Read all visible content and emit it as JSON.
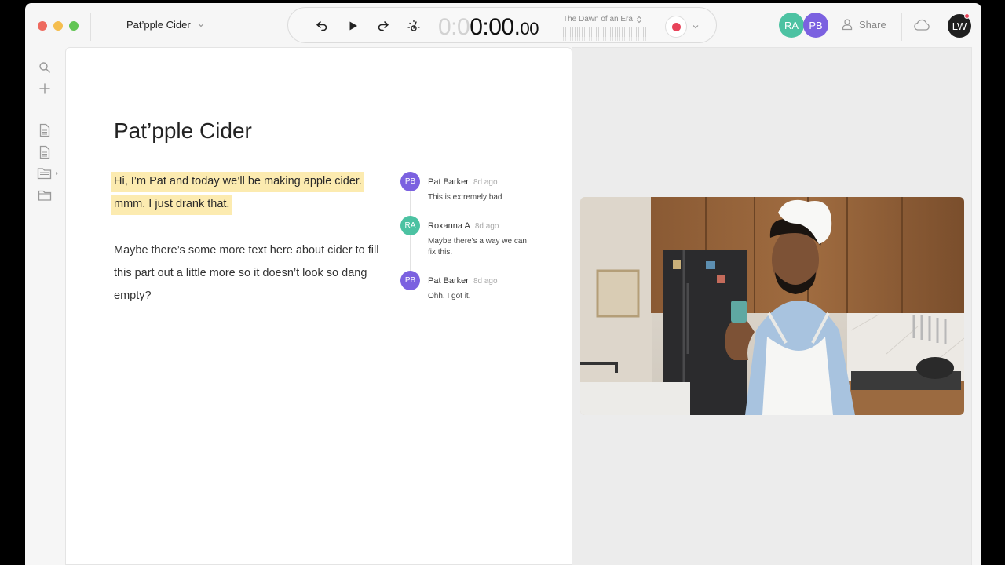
{
  "window": {
    "title": "Pat’pple Cider"
  },
  "transport": {
    "timecode_dim": "0:0",
    "timecode_main": "0:00.",
    "timecode_frames": "00",
    "song_title": "The Dawn of an Era"
  },
  "collaborators": [
    {
      "initials": "RA",
      "color": "#4cc2a2"
    },
    {
      "initials": "PB",
      "color": "#7b61e0"
    }
  ],
  "share_label": "Share",
  "user": {
    "initials": "LW",
    "color": "#1e1e1e"
  },
  "document": {
    "heading": "Pat’pple Cider",
    "highlighted_text": "Hi, I’m Pat and today we’ll be making apple cider. mmm. I just drank that.",
    "body_text": "Maybe there’s some more text here about cider to fill this part out a little more so it doesn’t look so dang empty?"
  },
  "comments": [
    {
      "initials": "PB",
      "color": "#7b61e0",
      "author": "Pat Barker",
      "time": "8d ago",
      "text": "This is extremely bad"
    },
    {
      "initials": "RA",
      "color": "#4cc2a2",
      "author": "Roxanna A",
      "time": "8d ago",
      "text": "Maybe there’s a way we can fix this."
    },
    {
      "initials": "PB",
      "color": "#7b61e0",
      "author": "Pat Barker",
      "time": "8d ago",
      "text": "Ohh. I got it."
    }
  ],
  "icons": {
    "sidebar": [
      "search-icon",
      "plus-icon",
      "document-icon",
      "document-icon",
      "folder-open-icon",
      "folder-icon"
    ],
    "transport": [
      "rewind-icon",
      "play-icon",
      "forward-icon",
      "metronome-icon",
      "record-icon"
    ]
  }
}
